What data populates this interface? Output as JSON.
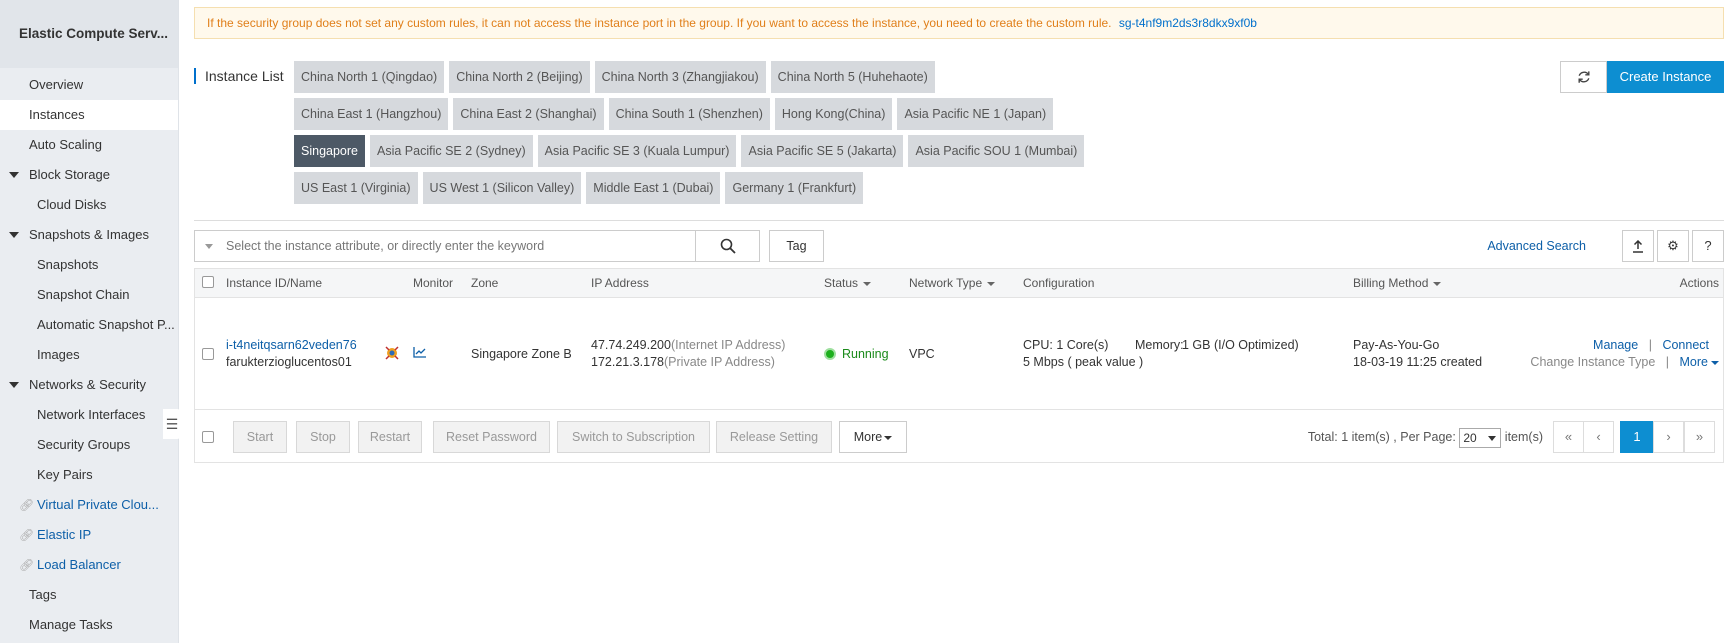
{
  "sidebar": {
    "title": "Elastic Compute Serv...",
    "items": [
      {
        "label": "Overview"
      },
      {
        "label": "Instances"
      },
      {
        "label": "Auto Scaling"
      },
      {
        "label": "Block Storage"
      },
      {
        "label": "Cloud Disks"
      },
      {
        "label": "Snapshots & Images"
      },
      {
        "label": "Snapshots"
      },
      {
        "label": "Snapshot Chain"
      },
      {
        "label": "Automatic Snapshot P..."
      },
      {
        "label": "Images"
      },
      {
        "label": "Networks & Security"
      },
      {
        "label": "Network Interfaces"
      },
      {
        "label": "Security Groups"
      },
      {
        "label": "Key Pairs"
      },
      {
        "label": "Virtual Private Clou..."
      },
      {
        "label": "Elastic IP"
      },
      {
        "label": "Load Balancer"
      },
      {
        "label": "Tags"
      },
      {
        "label": "Manage Tasks"
      }
    ]
  },
  "alert": {
    "text": "If the security group does not set any custom rules, it can not access the instance port in the group. If you want to access the instance, you need to create the custom rule.",
    "link": "sg-t4nf9m2ds3r8dkx9xf0b"
  },
  "header": {
    "title": "Instance List",
    "create_label": "Create Instance"
  },
  "regions": {
    "row1": [
      "China North 1 (Qingdao)",
      "China North 2 (Beijing)",
      "China North 3 (Zhangjiakou)",
      "China North 5 (Huhehaote)"
    ],
    "row2": [
      "China East 1 (Hangzhou)",
      "China East 2 (Shanghai)",
      "China South 1 (Shenzhen)",
      "Hong Kong(China)",
      "Asia Pacific NE 1 (Japan)"
    ],
    "row3": [
      "Singapore",
      "Asia Pacific SE 2 (Sydney)",
      "Asia Pacific SE 3 (Kuala Lumpur)",
      "Asia Pacific SE 5 (Jakarta)",
      "Asia Pacific SOU 1 (Mumbai)"
    ],
    "row4": [
      "US East 1 (Virginia)",
      "US West 1 (Silicon Valley)",
      "Middle East 1 (Dubai)",
      "Germany 1 (Frankfurt)"
    ],
    "selected": "Singapore"
  },
  "search": {
    "placeholder": "Select the instance attribute, or directly enter the keyword",
    "tag_label": "Tag",
    "advanced_label": "Advanced Search"
  },
  "table": {
    "headers": {
      "id_name": "Instance ID/Name",
      "monitor": "Monitor",
      "zone": "Zone",
      "ip": "IP Address",
      "status": "Status",
      "network": "Network Type",
      "config": "Configuration",
      "billing": "Billing Method",
      "actions": "Actions"
    },
    "row": {
      "id": "i-t4neitqsarn62veden76",
      "name": "farukterzioglucentos01",
      "zone": "Singapore Zone B",
      "ip_public": "47.74.249.200",
      "ip_public_tag": "(Internet IP Address)",
      "ip_private": "172.21.3.178",
      "ip_private_tag": "(Private IP Address)",
      "status": "Running",
      "network": "VPC",
      "config_cpu": "CPU: 1 Core(s)",
      "config_mem_label": "Memory:",
      "config_mem": "1 GB (I/O Optimized)",
      "config_bw": "5 Mbps ( peak value )",
      "billing": "Pay-As-You-Go",
      "created": "18-03-19 11:25 created",
      "action_manage": "Manage",
      "action_connect": "Connect",
      "action_change": "Change Instance Type",
      "action_more": "More",
      "separator": "|"
    }
  },
  "footer": {
    "buttons": [
      "Start",
      "Stop",
      "Restart",
      "Reset Password",
      "Switch to Subscription",
      "Release Setting"
    ],
    "more_label": "More",
    "total_label": "Total: 1 item(s) ,  Per Page:",
    "per_page": "20",
    "items_suffix": "item(s)",
    "pager": [
      "«",
      "‹",
      "1",
      "›",
      "»"
    ]
  }
}
